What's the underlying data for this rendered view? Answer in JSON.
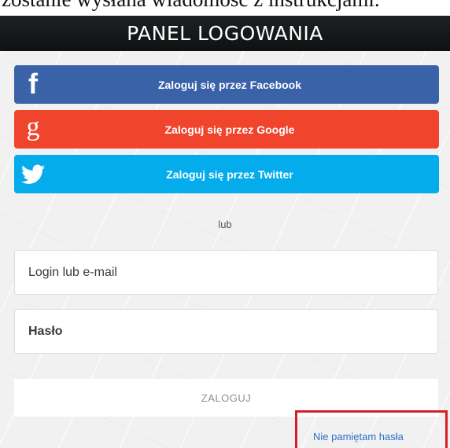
{
  "page": {
    "top_text": "zostanie wysłana wiadomość z instrukcjami."
  },
  "header": {
    "title": "PANEL LOGOWANIA"
  },
  "social": {
    "facebook": {
      "label": "Zaloguj się przez Facebook",
      "icon": "facebook-icon",
      "color": "#3a62a8"
    },
    "google": {
      "label": "Zaloguj się przez Google",
      "icon": "google-icon",
      "color": "#f1442d"
    },
    "twitter": {
      "label": "Zaloguj się przez Twitter",
      "icon": "twitter-icon",
      "color": "#05acec"
    }
  },
  "divider": {
    "text": "lub"
  },
  "form": {
    "login_placeholder": "Login lub e-mail",
    "password_placeholder": "Hasło",
    "submit_label": "ZALOGUJ",
    "forgot_label": "Nie pamiętam hasła"
  },
  "colors": {
    "header_bg": "#16191b",
    "highlight": "#d51f28",
    "link": "#2a6fc9"
  }
}
